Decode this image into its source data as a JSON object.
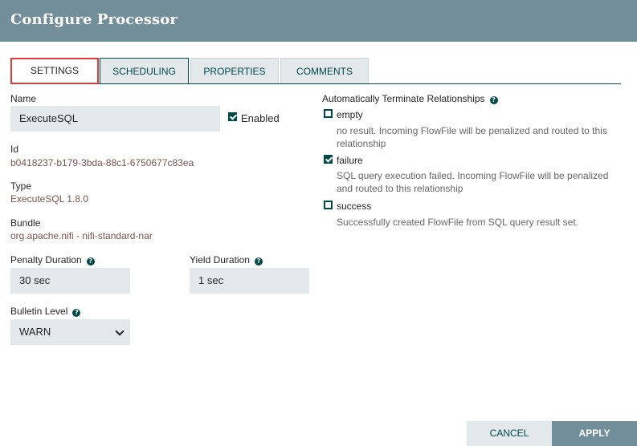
{
  "dialog": {
    "title": "Configure Processor"
  },
  "tabs": [
    {
      "label": "SETTINGS",
      "active": true
    },
    {
      "label": "SCHEDULING",
      "active": false
    },
    {
      "label": "PROPERTIES",
      "active": false
    },
    {
      "label": "COMMENTS",
      "active": false
    }
  ],
  "settings": {
    "name_label": "Name",
    "name_value": "ExecuteSQL",
    "enabled_label": "Enabled",
    "enabled": true,
    "id_label": "Id",
    "id_value": "b0418237-b179-3bda-88c1-6750677c83ea",
    "type_label": "Type",
    "type_value": "ExecuteSQL 1.8.0",
    "bundle_label": "Bundle",
    "bundle_value": "org.apache.nifi - nifi-standard-nar",
    "penalty_label": "Penalty Duration",
    "penalty_value": "30 sec",
    "yield_label": "Yield Duration",
    "yield_value": "1 sec",
    "bulletin_label": "Bulletin Level",
    "bulletin_value": "WARN"
  },
  "relationships": {
    "title": "Automatically Terminate Relationships",
    "items": [
      {
        "name": "empty",
        "checked": false,
        "description": "no result. Incoming FlowFile will be penalized and routed to this relationship"
      },
      {
        "name": "failure",
        "checked": true,
        "description": "SQL query execution failed. Incoming FlowFile will be penalized and routed to this relationship"
      },
      {
        "name": "success",
        "checked": false,
        "description": "Successfully created FlowFile from SQL query result set."
      }
    ]
  },
  "buttons": {
    "cancel": "CANCEL",
    "apply": "APPLY"
  },
  "help_icon": "?",
  "colors": {
    "header": "#728e9b",
    "accent": "#004849",
    "value": "#775351",
    "tab_highlight": "#e53935"
  }
}
